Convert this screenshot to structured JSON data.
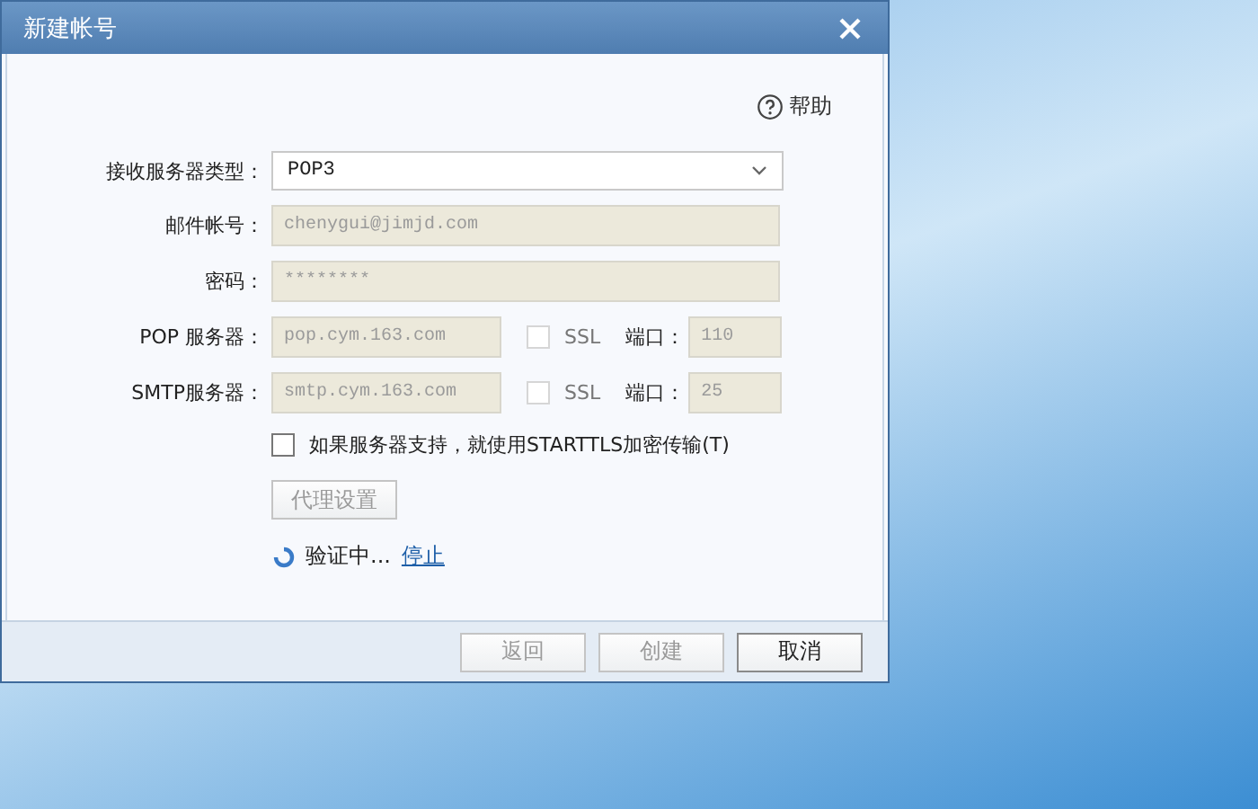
{
  "window": {
    "title": "新建帐号"
  },
  "help": {
    "label": "帮助"
  },
  "server_type": {
    "label": "接收服务器类型：",
    "value": "POP3"
  },
  "fields": [
    {
      "label": "邮件帐号：",
      "value": "chenygui@jimjd.com",
      "disabled": true
    },
    {
      "label": "密码：",
      "value": "********",
      "disabled": true
    }
  ],
  "servers": [
    {
      "label": "POP 服务器：",
      "value": "pop.cym.163.com",
      "disabled": true,
      "ssl_label": "SSL",
      "ssl_checked": false,
      "ssl_disabled": true,
      "port_label": "端口：",
      "port": "110"
    },
    {
      "label": "SMTP服务器：",
      "value": "smtp.cym.163.com",
      "disabled": true,
      "ssl_label": "SSL",
      "ssl_checked": false,
      "ssl_disabled": true,
      "port_label": "端口：",
      "port": "25"
    }
  ],
  "starttls": {
    "label": "如果服务器支持，就使用STARTTLS加密传输(T)",
    "checked": false
  },
  "proxy_button": {
    "label": "代理设置",
    "disabled": true
  },
  "status": {
    "text": "验证中...",
    "link": "停止"
  },
  "buttons": [
    {
      "label": "返回",
      "disabled": true
    },
    {
      "label": "创建",
      "disabled": true
    },
    {
      "label": "取消",
      "disabled": false
    }
  ]
}
